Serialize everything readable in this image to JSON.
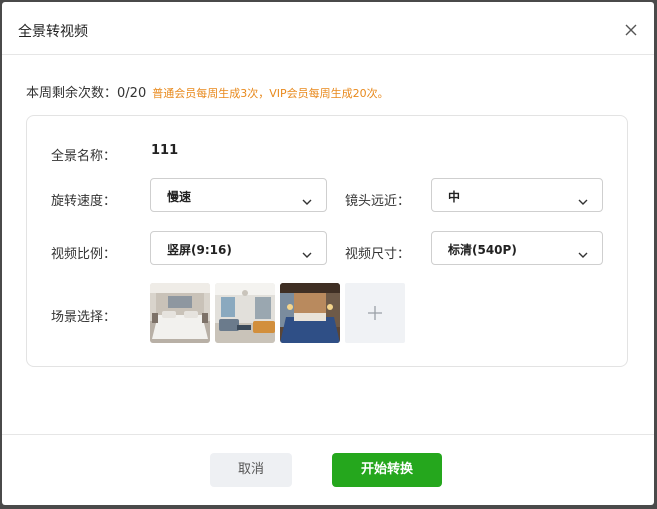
{
  "dialog": {
    "title": "全景转视频"
  },
  "quota": {
    "label": "本周剩余次数：",
    "value": "0/20",
    "note": "普通会员每周生成3次，VIP会员每周生成20次。"
  },
  "form": {
    "name_label": "全景名称：",
    "name_value": "111",
    "speed_label": "旋转速度：",
    "speed_value": "慢速",
    "distance_label": "镜头远近：",
    "distance_value": "中",
    "ratio_label": "视频比例：",
    "ratio_value": "竖屏(9:16)",
    "size_label": "视频尺寸：",
    "size_value": "标清(540P)",
    "scene_label": "场景选择："
  },
  "scenes": [
    {
      "name": "scene-1"
    },
    {
      "name": "scene-2"
    },
    {
      "name": "scene-3"
    }
  ],
  "footer": {
    "cancel_label": "取消",
    "start_label": "开始转换"
  },
  "colors": {
    "accent_green": "#25a71d",
    "note_orange": "#e8891c"
  }
}
